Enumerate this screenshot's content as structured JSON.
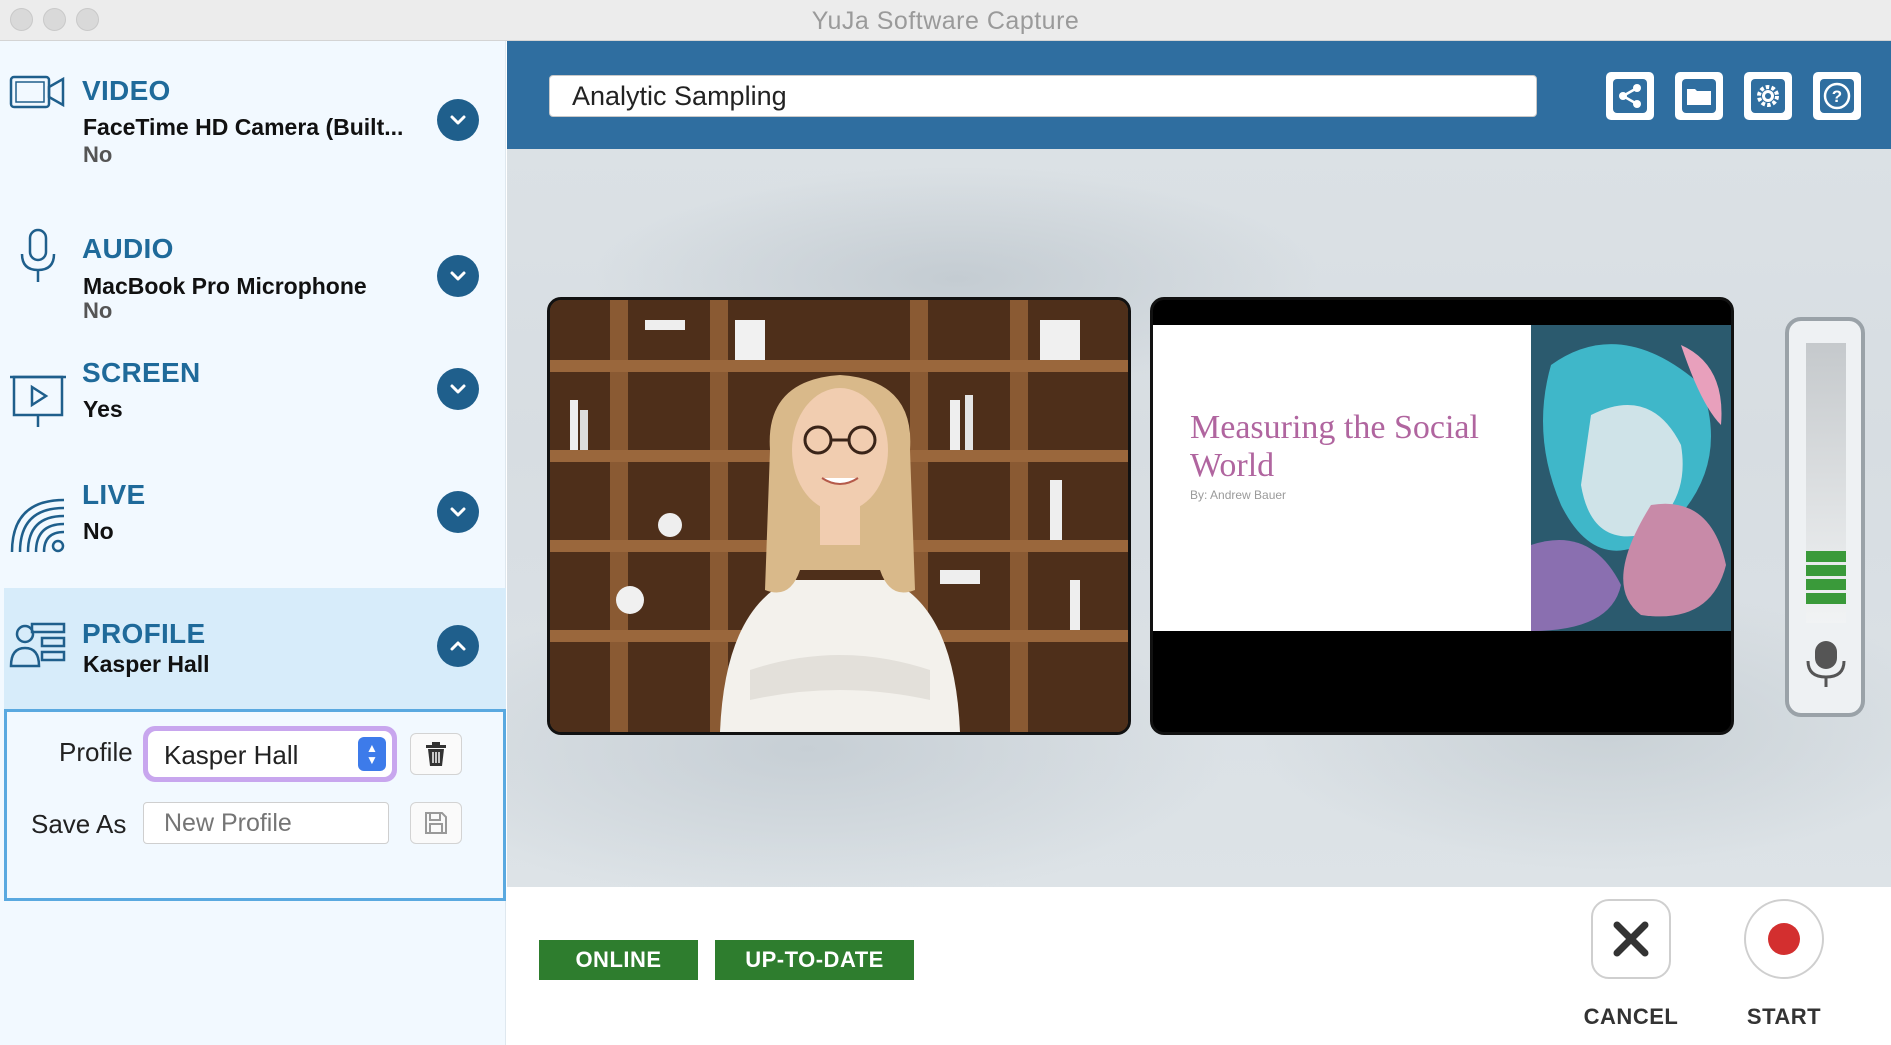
{
  "window": {
    "title": "YuJa Software Capture"
  },
  "sidebar": {
    "video": {
      "heading": "VIDEO",
      "line1": "FaceTime HD Camera (Built...",
      "line2": "No",
      "icon": "video-camera-icon"
    },
    "audio": {
      "heading": "AUDIO",
      "line1": "MacBook Pro Microphone",
      "line2": "No",
      "icon": "microphone-icon"
    },
    "screen": {
      "heading": "SCREEN",
      "line1": "Yes",
      "icon": "screen-presentation-icon"
    },
    "live": {
      "heading": "LIVE",
      "line1": "No",
      "icon": "broadcast-icon"
    },
    "profile": {
      "heading": "PROFILE",
      "line1": "Kasper Hall",
      "icon": "profile-list-icon"
    }
  },
  "profile_panel": {
    "profile_label": "Profile",
    "profile_value": "Kasper Hall",
    "save_as_label": "Save As",
    "save_as_placeholder": "New Profile"
  },
  "topbar": {
    "session_title": "Analytic Sampling",
    "buttons": [
      "share-icon",
      "folder-icon",
      "settings-gear-icon",
      "help-icon"
    ]
  },
  "slide_preview": {
    "title_line1": "Measuring the Social",
    "title_line2": "World",
    "author": "By: Andrew Bauer"
  },
  "status": {
    "online": "ONLINE",
    "uptodate": "UP-TO-DATE"
  },
  "actions": {
    "cancel": "CANCEL",
    "start": "START"
  },
  "colors": {
    "accent": "#2f6ea0",
    "status_green": "#2e7d2e",
    "record_red": "#d32f2f"
  }
}
